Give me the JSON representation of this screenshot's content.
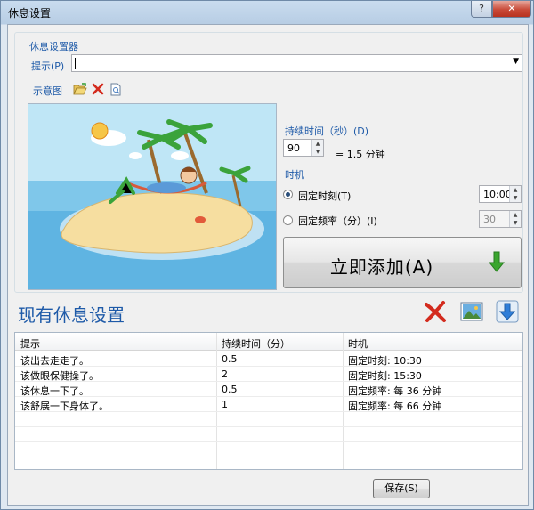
{
  "window": {
    "title": "休息设置",
    "help_label": "?",
    "close_label": "✕"
  },
  "settings_group": {
    "title": "休息设置器",
    "hint_label": "提示(P)",
    "hint_value": "",
    "sample_label": "示意图",
    "duration_label": "持续时间（秒）(D)",
    "duration_value": "90",
    "duration_equiv": "= 1.5 分钟",
    "time_label": "时机",
    "fixed_time_label": "固定时刻(T)",
    "fixed_time_value": "10:00",
    "fixed_time_selected": true,
    "fixed_freq_label": "固定频率（分）(I)",
    "fixed_freq_value": "30",
    "add_button_label": "立即添加(A)"
  },
  "existing": {
    "title": "现有休息设置",
    "columns": [
      "提示",
      "持续时间（分）",
      "时机"
    ],
    "rows": [
      {
        "hint": "该出去走走了。",
        "duration": "0.5",
        "timing": "固定时刻: 10:30"
      },
      {
        "hint": "该做眼保健操了。",
        "duration": "2",
        "timing": "固定时刻: 15:30"
      },
      {
        "hint": "该休息一下了。",
        "duration": "0.5",
        "timing": "固定频率: 每 36 分钟"
      },
      {
        "hint": "该舒展一下身体了。",
        "duration": "1",
        "timing": "固定频率: 每 66 分钟"
      }
    ]
  },
  "save_label": "保存(S)",
  "icons": {
    "open": "folder-open-icon",
    "delete": "red-x-icon",
    "preview": "document-preview-icon",
    "remove_all": "big-red-x-icon",
    "picture": "picture-icon",
    "download": "download-arrow-icon",
    "add_arrow": "green-down-arrow-icon"
  },
  "colors": {
    "accent": "#1e5aa8",
    "add_arrow": "#3aa52e",
    "delete": "#d32b1e",
    "title_bar": "#b7cde4"
  }
}
